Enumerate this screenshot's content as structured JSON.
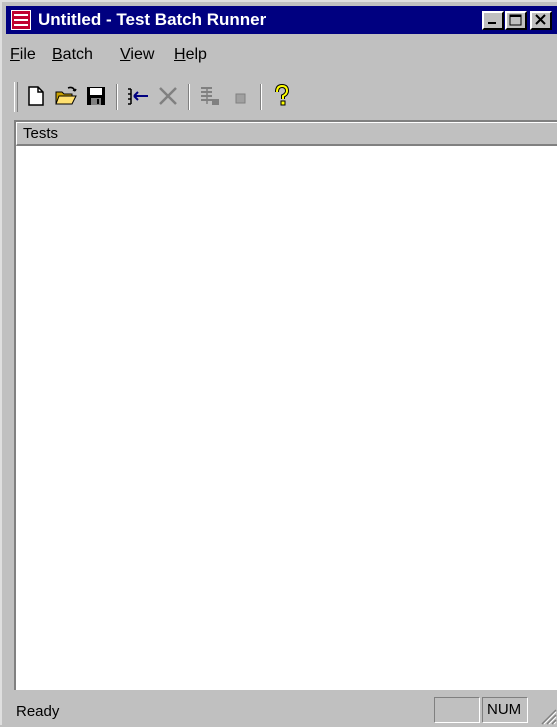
{
  "window": {
    "title": "Untitled - Test Batch Runner",
    "caption_colors": {
      "active": "#000080",
      "text": "#ffffff"
    }
  },
  "menu": {
    "items": [
      {
        "label": "File",
        "mnemonic": "F"
      },
      {
        "label": "Batch",
        "mnemonic": "B"
      },
      {
        "label": "View",
        "mnemonic": "V"
      },
      {
        "label": "Help",
        "mnemonic": "H"
      }
    ]
  },
  "toolbar": {
    "buttons": [
      {
        "icon": "new-document-icon",
        "enabled": true
      },
      {
        "icon": "open-folder-icon",
        "enabled": true
      },
      {
        "icon": "save-disk-icon",
        "enabled": true
      },
      {
        "icon": "add-test-icon",
        "enabled": true
      },
      {
        "icon": "remove-x-icon",
        "enabled": false
      },
      {
        "icon": "run-batch-icon",
        "enabled": false
      },
      {
        "icon": "stop-icon",
        "enabled": false
      },
      {
        "icon": "help-question-icon",
        "enabled": true
      }
    ]
  },
  "list": {
    "columns": [
      "Tests"
    ],
    "rows": []
  },
  "status": {
    "text": "Ready",
    "panes": [
      "",
      "NUM"
    ]
  }
}
